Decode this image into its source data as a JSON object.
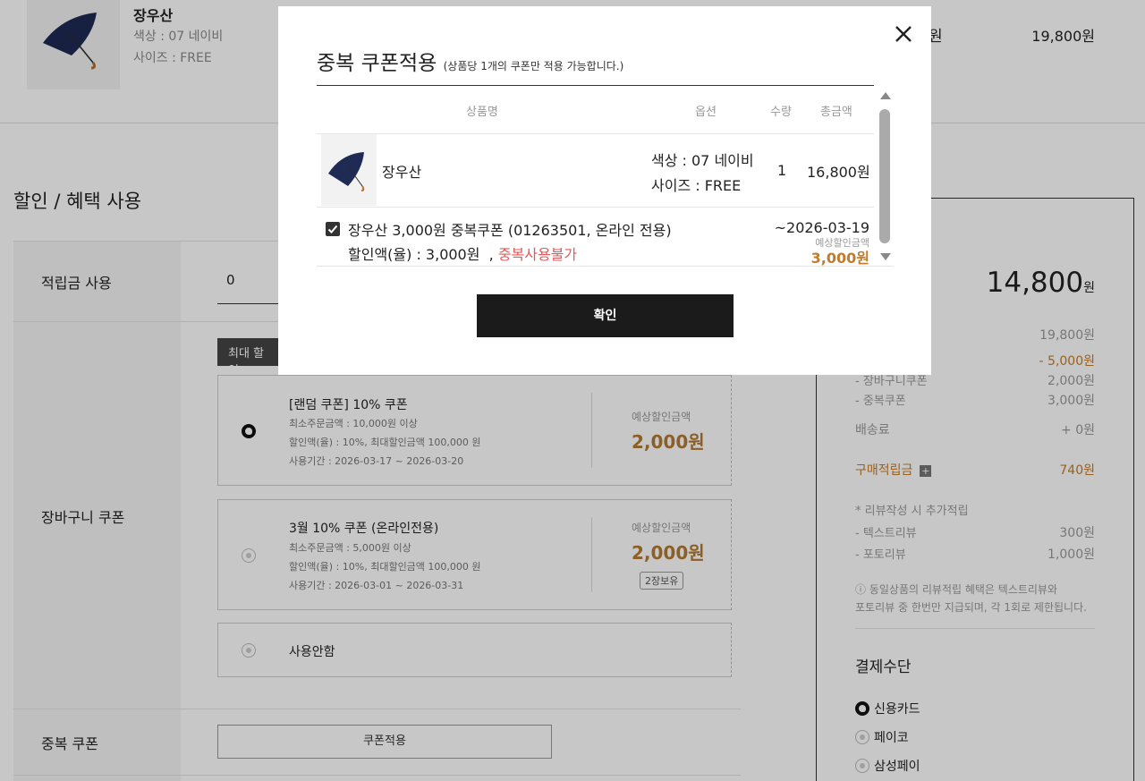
{
  "product": {
    "name": "장우산",
    "color": "색상 : 07 네이비",
    "size": "사이즈 : FREE",
    "price_mid": "원",
    "price": "19,800원"
  },
  "benefit": {
    "title": "할인 / 혜택 사용",
    "points_label": "적립금 사용",
    "points_value": "0",
    "max_badge": "최대 할인",
    "cart_coupon_label": "장바구니 쿠폰",
    "dup_coupon_label": "중복 쿠폰",
    "apply_button": "쿠폰적용",
    "coupons": [
      {
        "title": "[랜덤 쿠폰] 10% 쿠폰",
        "min": "최소주문금액 : 10,000원 이상",
        "rate": "할인액(율) : 10%,  최대할인금액 100,000 원",
        "period": "사용기간 : 2026-03-17 ~ 2026-03-20",
        "est_label": "예상할인금액",
        "est_value": "2,000원",
        "selected": true
      },
      {
        "title": "3월 10% 쿠폰 (온라인전용)",
        "min": "최소주문금액 : 5,000원 이상",
        "rate": "할인액(율) : 10%,  최대할인금액 100,000 원",
        "period": "사용기간 : 2026-03-01 ~ 2026-03-31",
        "est_label": "예상할인금액",
        "est_value": "2,000원",
        "hold": "2장보유",
        "selected": false
      }
    ],
    "no_use": "사용안함"
  },
  "summary": {
    "total": "14,800",
    "total_unit": "원",
    "order_amount": "19,800원",
    "discount": "- 5,000원",
    "cart_coupon_label": "- 장바구니쿠폰",
    "cart_coupon": "2,000원",
    "dup_coupon_label": "- 중복쿠폰",
    "dup_coupon": "3,000원",
    "shipping_label": "배송료",
    "shipping": "+ 0원",
    "points_label": "구매적립금",
    "points": "740원",
    "review_note": "* 리뷰작성 시 추가적립",
    "text_review_label": "- 텍스트리뷰",
    "text_review": "300원",
    "photo_review_label": "- 포토리뷰",
    "photo_review": "1,000원",
    "notice_1": "동일상품의 리뷰적립 혜택은 텍스트리뷰와",
    "notice_2": "포토리뷰 중 한번만 지급되며, 각 1회로 제한됩니다.",
    "payment_title": "결제수단",
    "payment_options": [
      "신용카드",
      "페이코",
      "삼성페이"
    ]
  },
  "modal": {
    "title": "중복 쿠폰적용",
    "subtitle": "(상품당 1개의 쿠폰만 적용 가능합니다.)",
    "headers": {
      "name": "상품명",
      "option": "옵션",
      "qty": "수량",
      "total": "총금액"
    },
    "item": {
      "name": "장우산",
      "color": "색상 : 07 네이비",
      "size": "사이즈 : FREE",
      "qty": "1",
      "price": "16,800원"
    },
    "coupon": {
      "name": "장우산 3,000원 중복쿠폰 (01263501, 온라인 전용)",
      "discount": "할인액(율) : 3,000원",
      "separator": ",",
      "warning": "중복사용불가",
      "expiry": "~2026-03-19",
      "est_label": "예상할인금액",
      "est_value": "3,000원",
      "checked": true
    },
    "confirm": "확인"
  }
}
